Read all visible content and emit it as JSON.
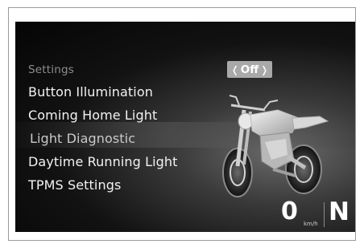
{
  "menu": {
    "header": "Settings",
    "items": [
      {
        "label": "Button Illumination"
      },
      {
        "label": "Coming Home Light"
      },
      {
        "label": "Light Diagnostic"
      },
      {
        "label": "Daytime Running Light"
      },
      {
        "label": "TPMS Settings"
      }
    ],
    "selected_item": "Light Diagnostic"
  },
  "value_selector": {
    "left_chevron": "❬",
    "value": "Off",
    "right_chevron": "❭"
  },
  "status": {
    "speed": "0",
    "speed_unit": "km/h",
    "gear": "N"
  },
  "colors": {
    "background": "#050505",
    "menu_text": "#f2f2f2",
    "header_text": "#8e8e8e",
    "pill": "#a9a9a9"
  },
  "icons": [
    "motorcycle-image"
  ]
}
